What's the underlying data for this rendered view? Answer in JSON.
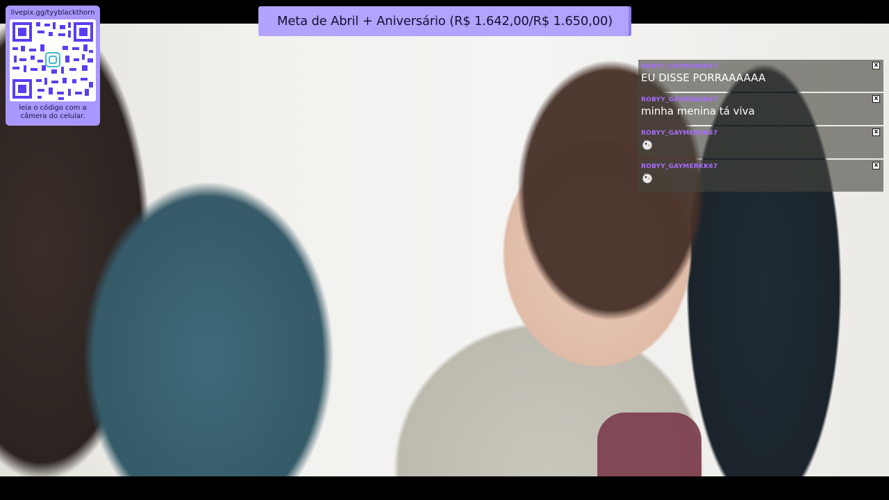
{
  "qr_panel": {
    "url": "livepix.gg/tyyblackthorn",
    "hint": "leia o código com a câmera do celular."
  },
  "goal": {
    "text": "Meta de Abril + Aniversário (R$ 1.642,00/R$ 1.650,00)"
  },
  "chat": {
    "messages": [
      {
        "user": "ROBYY_GAYMERKK67",
        "text": "EU DISSE PORRAAAAAA"
      },
      {
        "user": "ROBYY_GAYMERKK67",
        "text": "minha menina tá viva"
      },
      {
        "user": "ROBYY_GAYMERKK67",
        "emote": "bird-emote-icon"
      },
      {
        "user": "ROBYY_GAYMERKK67",
        "emote": "bird-emote-icon"
      }
    ],
    "close_glyph": "x"
  },
  "colors": {
    "panel_accent": "#a997ff",
    "goal_bg": "#b2a3ff",
    "chat_username": "#a86bff"
  }
}
